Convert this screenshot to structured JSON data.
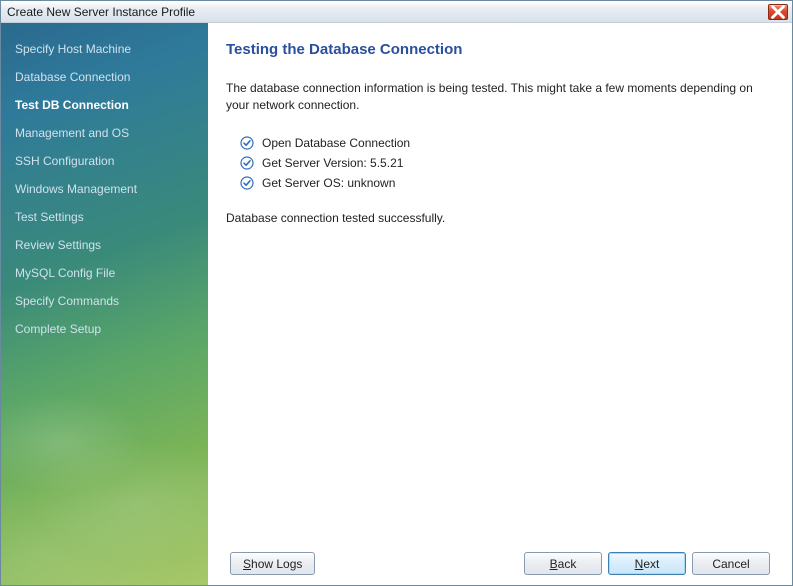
{
  "window": {
    "title": "Create New Server Instance Profile"
  },
  "sidebar": {
    "items": [
      {
        "label": "Specify Host Machine",
        "active": false
      },
      {
        "label": "Database Connection",
        "active": false
      },
      {
        "label": "Test DB Connection",
        "active": true
      },
      {
        "label": "Management and OS",
        "active": false
      },
      {
        "label": "SSH Configuration",
        "active": false
      },
      {
        "label": "Windows Management",
        "active": false
      },
      {
        "label": "Test Settings",
        "active": false
      },
      {
        "label": "Review Settings",
        "active": false
      },
      {
        "label": "MySQL Config File",
        "active": false
      },
      {
        "label": "Specify Commands",
        "active": false
      },
      {
        "label": "Complete Setup",
        "active": false
      }
    ]
  },
  "main": {
    "heading": "Testing the Database Connection",
    "description": "The database connection information is being tested. This might take a few moments depending on your network connection.",
    "checks": [
      {
        "label": "Open Database Connection"
      },
      {
        "label": "Get Server Version: 5.5.21"
      },
      {
        "label": "Get Server OS: unknown"
      }
    ],
    "result": "Database connection tested successfully."
  },
  "footer": {
    "show_logs": "Show Logs",
    "back": "Back",
    "next": "Next",
    "cancel": "Cancel"
  },
  "colors": {
    "heading": "#2a4f9e",
    "tick": "#2f6fc0"
  }
}
